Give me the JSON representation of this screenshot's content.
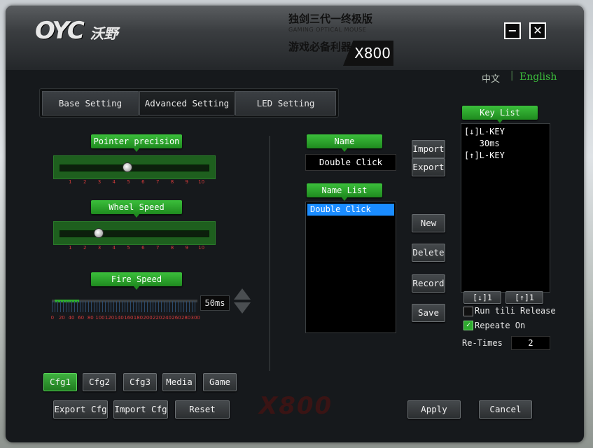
{
  "titlebar": {
    "logo_text": "OYC",
    "logo_cn": "沃野",
    "cn_title": "独剑三代一终极版",
    "en_subtitle": "GAMING OPTICAL MOUSE",
    "cn_slogan": "游戏必备利器",
    "model": "X800",
    "minimize": "−",
    "close": "✕"
  },
  "language": {
    "cn": "中文",
    "separator": "|",
    "en": "English",
    "active": "English"
  },
  "tabs": [
    {
      "label": "Base Setting",
      "active": false
    },
    {
      "label": "Advanced Setting",
      "active": true
    },
    {
      "label": "LED Setting",
      "active": false
    }
  ],
  "pointer_precision": {
    "label": "Pointer precision",
    "ticks": [
      "1",
      "2",
      "3",
      "4",
      "5",
      "6",
      "7",
      "8",
      "9",
      "10"
    ],
    "value": 5
  },
  "wheel_speed": {
    "label": "Wheel Speed",
    "ticks": [
      "1",
      "2",
      "3",
      "4",
      "5",
      "6",
      "7",
      "8",
      "9",
      "10"
    ],
    "value": 3
  },
  "fire_speed": {
    "label": "Fire Speed",
    "ticks": [
      "0",
      "20",
      "40",
      "60",
      "80",
      "100",
      "120",
      "140",
      "160",
      "180",
      "200",
      "220",
      "240",
      "260",
      "280",
      "300"
    ],
    "value_text": "50ms",
    "value_fraction": 0.17
  },
  "macro": {
    "name_label": "Name",
    "name_value": "Double Click",
    "name_list_label": "Name List",
    "name_list": [
      "Double Click"
    ],
    "selected_index": 0,
    "import_label": "Import",
    "export_label": "Export",
    "new_label": "New",
    "delete_label": "Delete",
    "record_label": "Record",
    "save_label": "Save"
  },
  "key_list": {
    "label": "Key List",
    "items": [
      "[↓]L-KEY",
      "   30ms",
      "[↑]L-KEY"
    ],
    "down_btn": "[↓]1",
    "up_btn": "[↑]1",
    "run_release_label": "Run tili Release",
    "run_release_checked": false,
    "repeat_label": "Repeate On",
    "repeat_checked": true,
    "retimes_label": "Re-Times",
    "retimes_value": "2"
  },
  "configs": [
    {
      "label": "Cfg1",
      "active": true
    },
    {
      "label": "Cfg2",
      "active": false
    },
    {
      "label": "Cfg3",
      "active": false
    },
    {
      "label": "Media",
      "active": false
    },
    {
      "label": "Game",
      "active": false
    }
  ],
  "bottom": {
    "export_cfg": "Export Cfg",
    "import_cfg": "Import Cfg",
    "reset": "Reset",
    "apply": "Apply",
    "cancel": "Cancel",
    "watermark": "X800"
  },
  "colors": {
    "accent_green": "#2eaa2e",
    "selection_blue": "#1a8cff",
    "tick_red": "#d23a3a"
  }
}
